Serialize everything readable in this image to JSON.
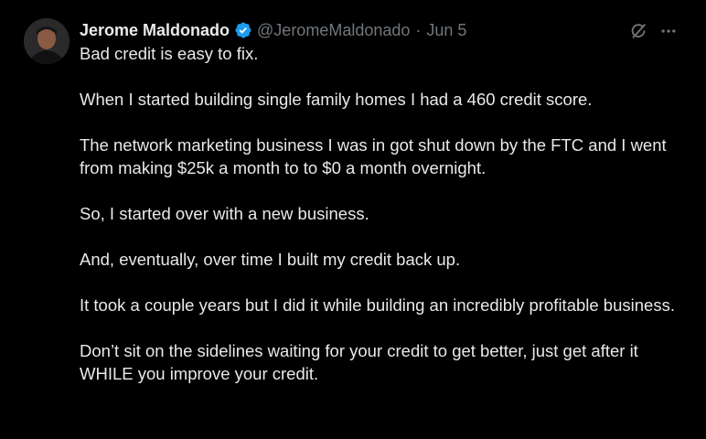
{
  "author": {
    "name": "Jerome Maldonado",
    "handle": "@JeromeMaldonado",
    "separator": "·",
    "date": "Jun 5",
    "verified_color": "#1d9bf0"
  },
  "icons": {
    "avatar": "avatar",
    "verified": "verified-badge-icon",
    "grok": "grok-icon",
    "more": "more-options-icon"
  },
  "colors": {
    "background": "#000000",
    "text": "#e7e9ea",
    "secondary_text": "#71767b"
  },
  "tweet": {
    "paragraphs": [
      "Bad credit is easy to fix.",
      "When I started building single family homes I had a 460 credit score.",
      "The network marketing business I was in got shut down by the FTC and I went from making $25k a month to to $0 a month overnight.",
      "So, I started over with a new business.",
      "And, eventually, over time I built my credit back up.",
      "It took a couple years but I did it while building an incredibly profitable business.",
      "Don’t sit on the sidelines waiting for your credit to get better, just get after it WHILE you improve your credit."
    ]
  }
}
